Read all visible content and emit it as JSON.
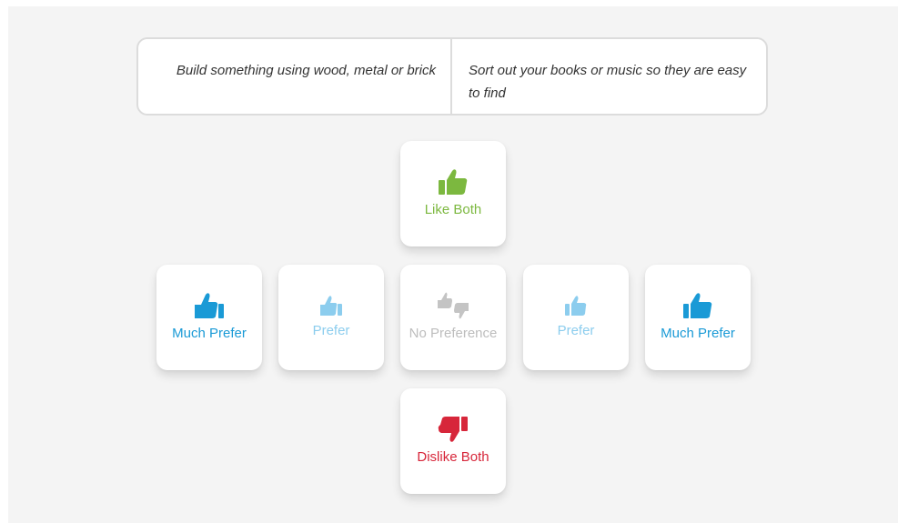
{
  "statements": {
    "left": "Build something using wood, metal or brick",
    "right": "Sort out your books or music so they are easy to find"
  },
  "options": {
    "like_both": {
      "label": "Like Both",
      "icon": "thumbs-up-icon",
      "color": "#7cb83f"
    },
    "much_prefer_left": {
      "label": "Much Prefer",
      "icon": "thumbs-up-large-icon",
      "color": "#1a9ad6"
    },
    "prefer_left": {
      "label": "Prefer",
      "icon": "thumbs-up-small-icon",
      "color": "#8ccdee"
    },
    "no_preference": {
      "label": "No Preference",
      "icon": "thumbs-up-down-icon",
      "color": "#bdbdbd"
    },
    "prefer_right": {
      "label": "Prefer",
      "icon": "thumbs-up-small-icon",
      "color": "#8ccdee"
    },
    "much_prefer_right": {
      "label": "Much Prefer",
      "icon": "thumbs-up-large-icon",
      "color": "#1a9ad6"
    },
    "dislike_both": {
      "label": "Dislike Both",
      "icon": "thumbs-down-icon",
      "color": "#d7263a"
    }
  }
}
